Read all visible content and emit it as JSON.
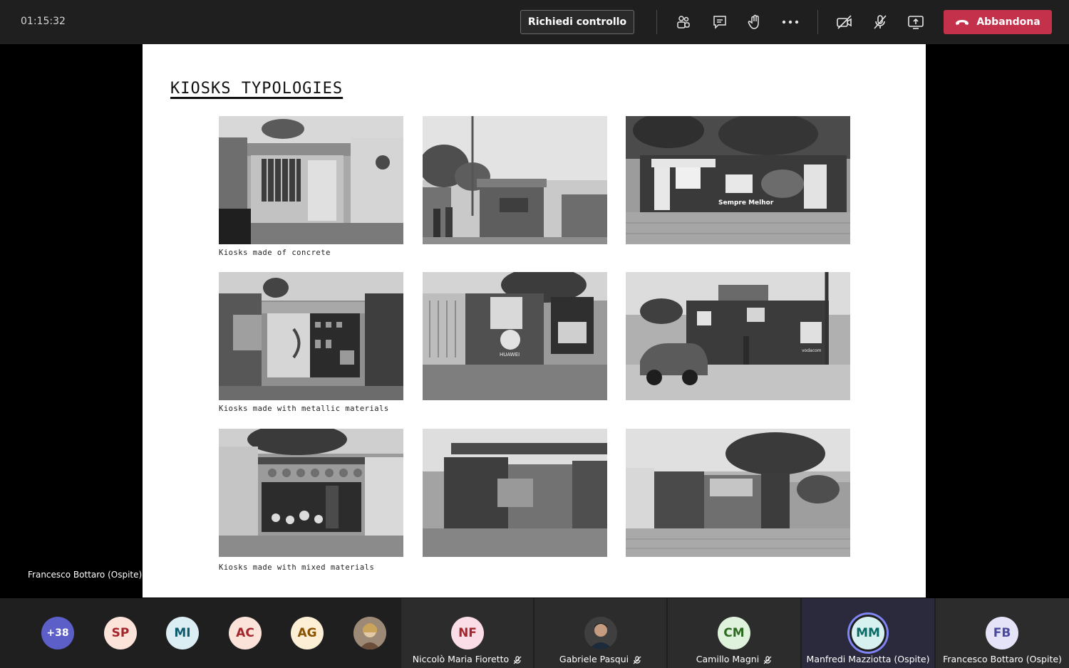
{
  "top_bar": {
    "timer": "01:15:32",
    "control_button": "Richiedi controllo",
    "leave_button": "Abbandona",
    "icons": [
      "participants-icon",
      "chat-icon",
      "raise-hand-icon",
      "more-icon",
      "camera-off-icon",
      "mic-off-icon",
      "share-screen-icon"
    ]
  },
  "slide": {
    "title": "KIOSKS TYPOLOGIES",
    "captions": {
      "concrete": "Kiosks made of concrete",
      "metallic": "Kiosks made with metallic materials",
      "mixed": "Kiosks made with mixed materials"
    },
    "photo_labels": {
      "sign_text": "Sempre Melhor",
      "brand_huawei": "HUAWEI",
      "brand_vodacom": "vodacom"
    }
  },
  "presenter_label": "Francesco Bottaro (Ospite)",
  "participants": {
    "overflow": "+38",
    "avatars": [
      {
        "initials": "SP",
        "bg": "#fbe3da",
        "fg": "#a4262c"
      },
      {
        "initials": "MI",
        "bg": "#dbeef3",
        "fg": "#0e5a6e"
      },
      {
        "initials": "AC",
        "bg": "#fbe3da",
        "fg": "#a4262c"
      },
      {
        "initials": "AG",
        "bg": "#fcefd6",
        "fg": "#8a5300"
      }
    ],
    "tiles": [
      {
        "initials": "NF",
        "name": "Niccolò Maria Fioretto",
        "bg": "#fbdde8",
        "fg": "#a4262c"
      },
      {
        "initials": "",
        "name": "Gabriele Pasqui",
        "bg": "#555",
        "fg": "#fff"
      },
      {
        "initials": "CM",
        "name": "Camillo Magni",
        "bg": "#dff3dc",
        "fg": "#2d6a1f"
      },
      {
        "initials": "MM",
        "name": "Manfredi Mazziotta (Ospite)",
        "bg": "#d6f1ef",
        "fg": "#0b6a66"
      },
      {
        "initials": "FB",
        "name": "Francesco Bottaro (Ospite)",
        "bg": "#e4e3f7",
        "fg": "#4b4a9e"
      }
    ]
  },
  "colors": {
    "leave": "#c4314b",
    "overflow_avatar": "#5b5fc7",
    "speaking_ring": "#7f85f5"
  }
}
